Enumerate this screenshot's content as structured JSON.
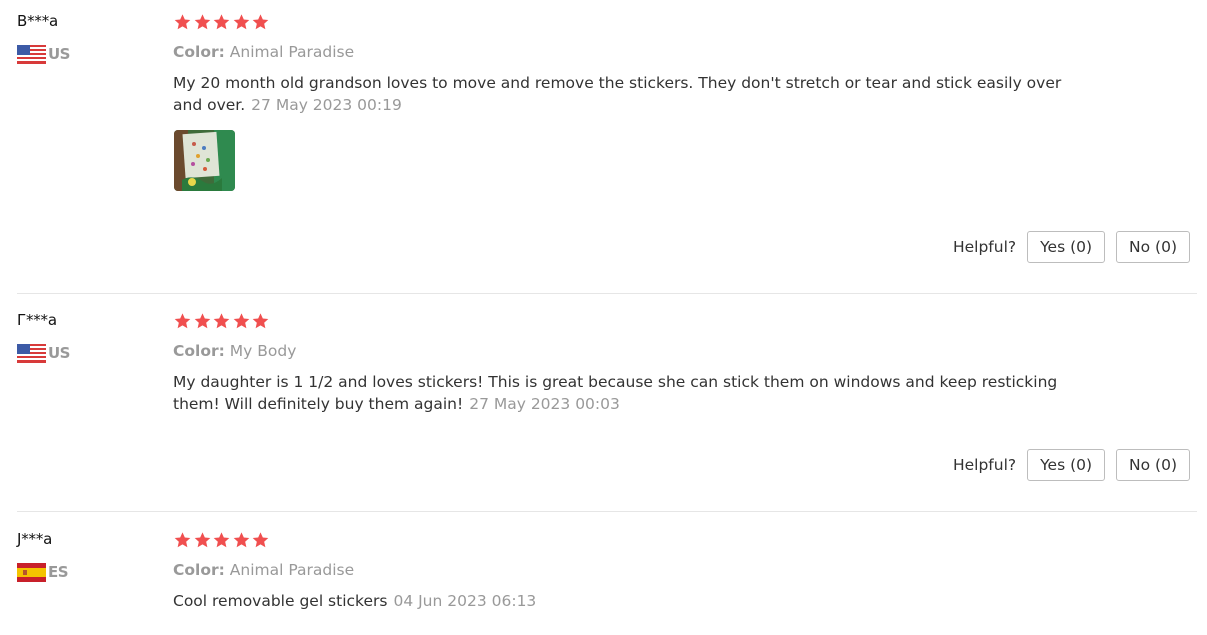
{
  "helpful_label": "Helpful?",
  "color_label": "Color:",
  "star_color": "#f04f4f",
  "reviews": [
    {
      "name": "B***a",
      "country": "US",
      "flag": "us-flag-icon",
      "rating": 5,
      "color_value": "Animal Paradise",
      "text": "My 20 month old grandson loves to move and remove the stickers. They don't stretch or tear and stick easily over and over.",
      "date": "27 May 2023 00:19",
      "has_photo": true,
      "yes_label": "Yes (0)",
      "no_label": "No (0)"
    },
    {
      "name": "Г***а",
      "country": "US",
      "flag": "us-flag-icon",
      "rating": 5,
      "color_value": "My Body",
      "text": "My daughter is 1 1/2 and loves stickers! This is great because she can stick them on windows and keep resticking them! Will definitely buy them again!",
      "date": "27 May 2023 00:03",
      "has_photo": false,
      "yes_label": "Yes (0)",
      "no_label": "No (0)"
    },
    {
      "name": "J***a",
      "country": "ES",
      "flag": "es-flag-icon",
      "rating": 5,
      "color_value": "Animal Paradise",
      "text": "Cool removable gel stickers",
      "date": "04 Jun 2023 06:13",
      "has_photo": false
    }
  ]
}
